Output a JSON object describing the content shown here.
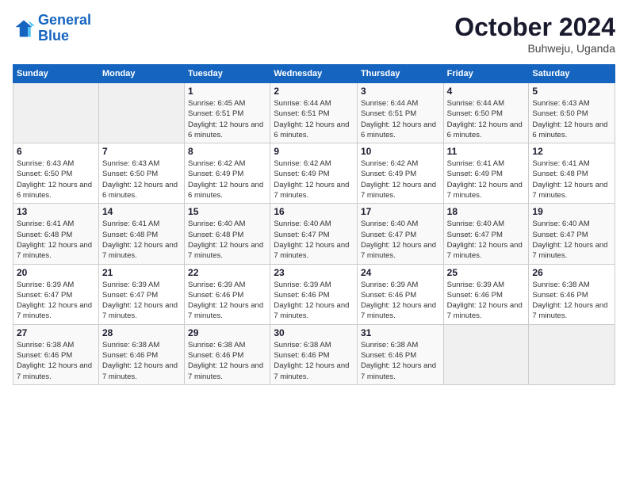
{
  "header": {
    "logo_line1": "General",
    "logo_line2": "Blue",
    "month": "October 2024",
    "location": "Buhweju, Uganda"
  },
  "weekdays": [
    "Sunday",
    "Monday",
    "Tuesday",
    "Wednesday",
    "Thursday",
    "Friday",
    "Saturday"
  ],
  "weeks": [
    [
      {
        "day": "",
        "info": ""
      },
      {
        "day": "",
        "info": ""
      },
      {
        "day": "1",
        "info": "Sunrise: 6:45 AM\nSunset: 6:51 PM\nDaylight: 12 hours and 6 minutes."
      },
      {
        "day": "2",
        "info": "Sunrise: 6:44 AM\nSunset: 6:51 PM\nDaylight: 12 hours and 6 minutes."
      },
      {
        "day": "3",
        "info": "Sunrise: 6:44 AM\nSunset: 6:51 PM\nDaylight: 12 hours and 6 minutes."
      },
      {
        "day": "4",
        "info": "Sunrise: 6:44 AM\nSunset: 6:50 PM\nDaylight: 12 hours and 6 minutes."
      },
      {
        "day": "5",
        "info": "Sunrise: 6:43 AM\nSunset: 6:50 PM\nDaylight: 12 hours and 6 minutes."
      }
    ],
    [
      {
        "day": "6",
        "info": "Sunrise: 6:43 AM\nSunset: 6:50 PM\nDaylight: 12 hours and 6 minutes."
      },
      {
        "day": "7",
        "info": "Sunrise: 6:43 AM\nSunset: 6:50 PM\nDaylight: 12 hours and 6 minutes."
      },
      {
        "day": "8",
        "info": "Sunrise: 6:42 AM\nSunset: 6:49 PM\nDaylight: 12 hours and 6 minutes."
      },
      {
        "day": "9",
        "info": "Sunrise: 6:42 AM\nSunset: 6:49 PM\nDaylight: 12 hours and 7 minutes."
      },
      {
        "day": "10",
        "info": "Sunrise: 6:42 AM\nSunset: 6:49 PM\nDaylight: 12 hours and 7 minutes."
      },
      {
        "day": "11",
        "info": "Sunrise: 6:41 AM\nSunset: 6:49 PM\nDaylight: 12 hours and 7 minutes."
      },
      {
        "day": "12",
        "info": "Sunrise: 6:41 AM\nSunset: 6:48 PM\nDaylight: 12 hours and 7 minutes."
      }
    ],
    [
      {
        "day": "13",
        "info": "Sunrise: 6:41 AM\nSunset: 6:48 PM\nDaylight: 12 hours and 7 minutes."
      },
      {
        "day": "14",
        "info": "Sunrise: 6:41 AM\nSunset: 6:48 PM\nDaylight: 12 hours and 7 minutes."
      },
      {
        "day": "15",
        "info": "Sunrise: 6:40 AM\nSunset: 6:48 PM\nDaylight: 12 hours and 7 minutes."
      },
      {
        "day": "16",
        "info": "Sunrise: 6:40 AM\nSunset: 6:47 PM\nDaylight: 12 hours and 7 minutes."
      },
      {
        "day": "17",
        "info": "Sunrise: 6:40 AM\nSunset: 6:47 PM\nDaylight: 12 hours and 7 minutes."
      },
      {
        "day": "18",
        "info": "Sunrise: 6:40 AM\nSunset: 6:47 PM\nDaylight: 12 hours and 7 minutes."
      },
      {
        "day": "19",
        "info": "Sunrise: 6:40 AM\nSunset: 6:47 PM\nDaylight: 12 hours and 7 minutes."
      }
    ],
    [
      {
        "day": "20",
        "info": "Sunrise: 6:39 AM\nSunset: 6:47 PM\nDaylight: 12 hours and 7 minutes."
      },
      {
        "day": "21",
        "info": "Sunrise: 6:39 AM\nSunset: 6:47 PM\nDaylight: 12 hours and 7 minutes."
      },
      {
        "day": "22",
        "info": "Sunrise: 6:39 AM\nSunset: 6:46 PM\nDaylight: 12 hours and 7 minutes."
      },
      {
        "day": "23",
        "info": "Sunrise: 6:39 AM\nSunset: 6:46 PM\nDaylight: 12 hours and 7 minutes."
      },
      {
        "day": "24",
        "info": "Sunrise: 6:39 AM\nSunset: 6:46 PM\nDaylight: 12 hours and 7 minutes."
      },
      {
        "day": "25",
        "info": "Sunrise: 6:39 AM\nSunset: 6:46 PM\nDaylight: 12 hours and 7 minutes."
      },
      {
        "day": "26",
        "info": "Sunrise: 6:38 AM\nSunset: 6:46 PM\nDaylight: 12 hours and 7 minutes."
      }
    ],
    [
      {
        "day": "27",
        "info": "Sunrise: 6:38 AM\nSunset: 6:46 PM\nDaylight: 12 hours and 7 minutes."
      },
      {
        "day": "28",
        "info": "Sunrise: 6:38 AM\nSunset: 6:46 PM\nDaylight: 12 hours and 7 minutes."
      },
      {
        "day": "29",
        "info": "Sunrise: 6:38 AM\nSunset: 6:46 PM\nDaylight: 12 hours and 7 minutes."
      },
      {
        "day": "30",
        "info": "Sunrise: 6:38 AM\nSunset: 6:46 PM\nDaylight: 12 hours and 7 minutes."
      },
      {
        "day": "31",
        "info": "Sunrise: 6:38 AM\nSunset: 6:46 PM\nDaylight: 12 hours and 7 minutes."
      },
      {
        "day": "",
        "info": ""
      },
      {
        "day": "",
        "info": ""
      }
    ]
  ]
}
